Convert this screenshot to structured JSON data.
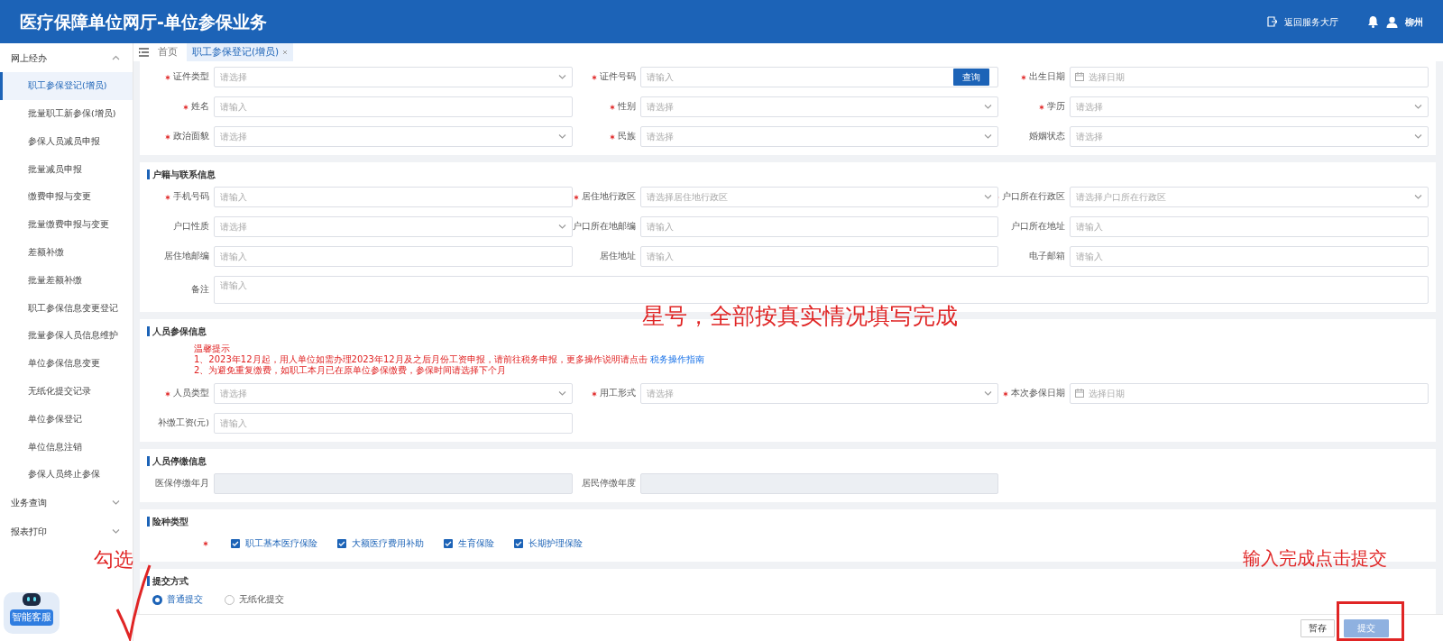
{
  "header": {
    "title": "医疗保障单位网厅-单位参保业务",
    "return_link": "返回服务大厅",
    "user": "柳州"
  },
  "sidebar": {
    "groups": [
      {
        "label": "网上经办",
        "expanded": true,
        "items": [
          {
            "label": "职工参保登记(增员)",
            "selected": true
          },
          {
            "label": "批量职工新参保(增员)",
            "selected": false
          },
          {
            "label": "参保人员减员申报",
            "selected": false
          },
          {
            "label": "批量减员申报",
            "selected": false
          },
          {
            "label": "缴费申报与变更",
            "selected": false
          },
          {
            "label": "批量缴费申报与变更",
            "selected": false
          },
          {
            "label": "差额补缴",
            "selected": false
          },
          {
            "label": "批量差额补缴",
            "selected": false
          },
          {
            "label": "职工参保信息变更登记",
            "selected": false
          },
          {
            "label": "批量参保人员信息维护",
            "selected": false
          },
          {
            "label": "单位参保信息变更",
            "selected": false
          },
          {
            "label": "无纸化提交记录",
            "selected": false
          },
          {
            "label": "单位参保登记",
            "selected": false
          },
          {
            "label": "单位信息注销",
            "selected": false
          },
          {
            "label": "参保人员终止参保",
            "selected": false
          }
        ]
      },
      {
        "label": "业务查询",
        "expanded": false
      },
      {
        "label": "报表打印",
        "expanded": false
      }
    ],
    "assistant_label": "智能客服"
  },
  "tabs": [
    {
      "label": "首页",
      "selected": false,
      "closable": false
    },
    {
      "label": "职工参保登记(增员)",
      "selected": true,
      "closable": true
    }
  ],
  "sections": [
    {
      "kind": "fields",
      "fields": [
        {
          "label": "证件类型",
          "required": true,
          "kind": "select",
          "placeholder": "请选择",
          "disabled": false
        },
        {
          "label": "证件号码",
          "required": true,
          "kind": "input",
          "placeholder": "请输入",
          "disabled": false,
          "action": "查询"
        },
        {
          "label": "出生日期",
          "required": true,
          "kind": "date",
          "placeholder": "选择日期",
          "disabled": false
        },
        {
          "label": "姓名",
          "required": true,
          "kind": "input",
          "placeholder": "请输入",
          "disabled": false
        },
        {
          "label": "性别",
          "required": true,
          "kind": "select",
          "placeholder": "请选择",
          "disabled": false
        },
        {
          "label": "学历",
          "required": true,
          "kind": "select",
          "placeholder": "请选择",
          "disabled": false
        },
        {
          "label": "政治面貌",
          "required": true,
          "kind": "select",
          "placeholder": "请选择",
          "disabled": false
        },
        {
          "label": "民族",
          "required": true,
          "kind": "select",
          "placeholder": "请选择",
          "disabled": false
        },
        {
          "label": "婚姻状态",
          "required": false,
          "kind": "select",
          "placeholder": "请选择",
          "disabled": false
        }
      ]
    },
    {
      "kind": "fields",
      "title": "户籍与联系信息",
      "fields": [
        {
          "label": "手机号码",
          "required": true,
          "kind": "input",
          "placeholder": "请输入",
          "disabled": false
        },
        {
          "label": "居住地行政区",
          "required": true,
          "kind": "select",
          "placeholder": "请选择居住地行政区",
          "disabled": false
        },
        {
          "label": "户口所在行政区",
          "required": true,
          "kind": "select",
          "placeholder": "请选择户口所在行政区",
          "disabled": false
        },
        {
          "label": "户口性质",
          "required": false,
          "kind": "select",
          "placeholder": "请选择",
          "disabled": false
        },
        {
          "label": "户口所在地邮编",
          "required": false,
          "kind": "input",
          "placeholder": "请输入",
          "disabled": false
        },
        {
          "label": "户口所在地址",
          "required": false,
          "kind": "input",
          "placeholder": "请输入",
          "disabled": false
        },
        {
          "label": "居住地邮编",
          "required": false,
          "kind": "input",
          "placeholder": "请输入",
          "disabled": false
        },
        {
          "label": "居住地址",
          "required": false,
          "kind": "input",
          "placeholder": "请输入",
          "disabled": false
        },
        {
          "label": "电子邮箱",
          "required": false,
          "kind": "input",
          "placeholder": "请输入",
          "disabled": false
        },
        {
          "label": "备注",
          "required": false,
          "kind": "textarea",
          "placeholder": "请输入",
          "disabled": false
        }
      ]
    },
    {
      "kind": "fields",
      "title": "人员参保信息",
      "notice": {
        "title": "温馨提示",
        "lines": [
          {
            "text": "1、2023年12月起，用人单位如需办理2023年12月及之后月份工资申报，请前往税务申报，更多操作说明请点击",
            "link": "税务操作指南"
          },
          {
            "text": "2、为避免重复缴费，如职工本月已在原单位参保缴费，参保时间请选择下个月"
          }
        ]
      },
      "fields": [
        {
          "label": "人员类型",
          "required": true,
          "kind": "select",
          "placeholder": "请选择",
          "disabled": false
        },
        {
          "label": "用工形式",
          "required": true,
          "kind": "select",
          "placeholder": "请选择",
          "disabled": false
        },
        {
          "label": "本次参保日期",
          "required": true,
          "kind": "date",
          "placeholder": "选择日期",
          "disabled": false
        },
        {
          "label": "补缴工资(元)",
          "required": false,
          "kind": "input",
          "placeholder": "请输入",
          "disabled": false
        }
      ]
    },
    {
      "kind": "fields",
      "title": "人员停缴信息",
      "fields": [
        {
          "label": "医保停缴年月",
          "required": false,
          "kind": "input",
          "disabled": true
        },
        {
          "label": "居民停缴年度",
          "required": false,
          "kind": "input",
          "disabled": true
        }
      ]
    },
    {
      "kind": "checkboxes",
      "title": "险种类型",
      "required": true,
      "items": [
        {
          "label": "职工基本医疗保险",
          "checked": true
        },
        {
          "label": "大额医疗费用补助",
          "checked": true
        },
        {
          "label": "生育保险",
          "checked": true
        },
        {
          "label": "长期护理保险",
          "checked": true
        }
      ]
    },
    {
      "kind": "radios",
      "title": "提交方式",
      "items": [
        {
          "label": "普通提交",
          "selected": true
        },
        {
          "label": "无纸化提交",
          "selected": false
        }
      ]
    }
  ],
  "footer_buttons": [
    {
      "label": "暂存",
      "kind": "secondary"
    },
    {
      "label": "提交",
      "kind": "primary"
    }
  ],
  "annotations": [
    {
      "kind": "note",
      "text": "星号，全部按真实情况填写完成"
    },
    {
      "kind": "note",
      "text": "勾选"
    },
    {
      "kind": "tick"
    },
    {
      "kind": "note",
      "text": "输入完成点击提交"
    },
    {
      "kind": "frame"
    }
  ]
}
